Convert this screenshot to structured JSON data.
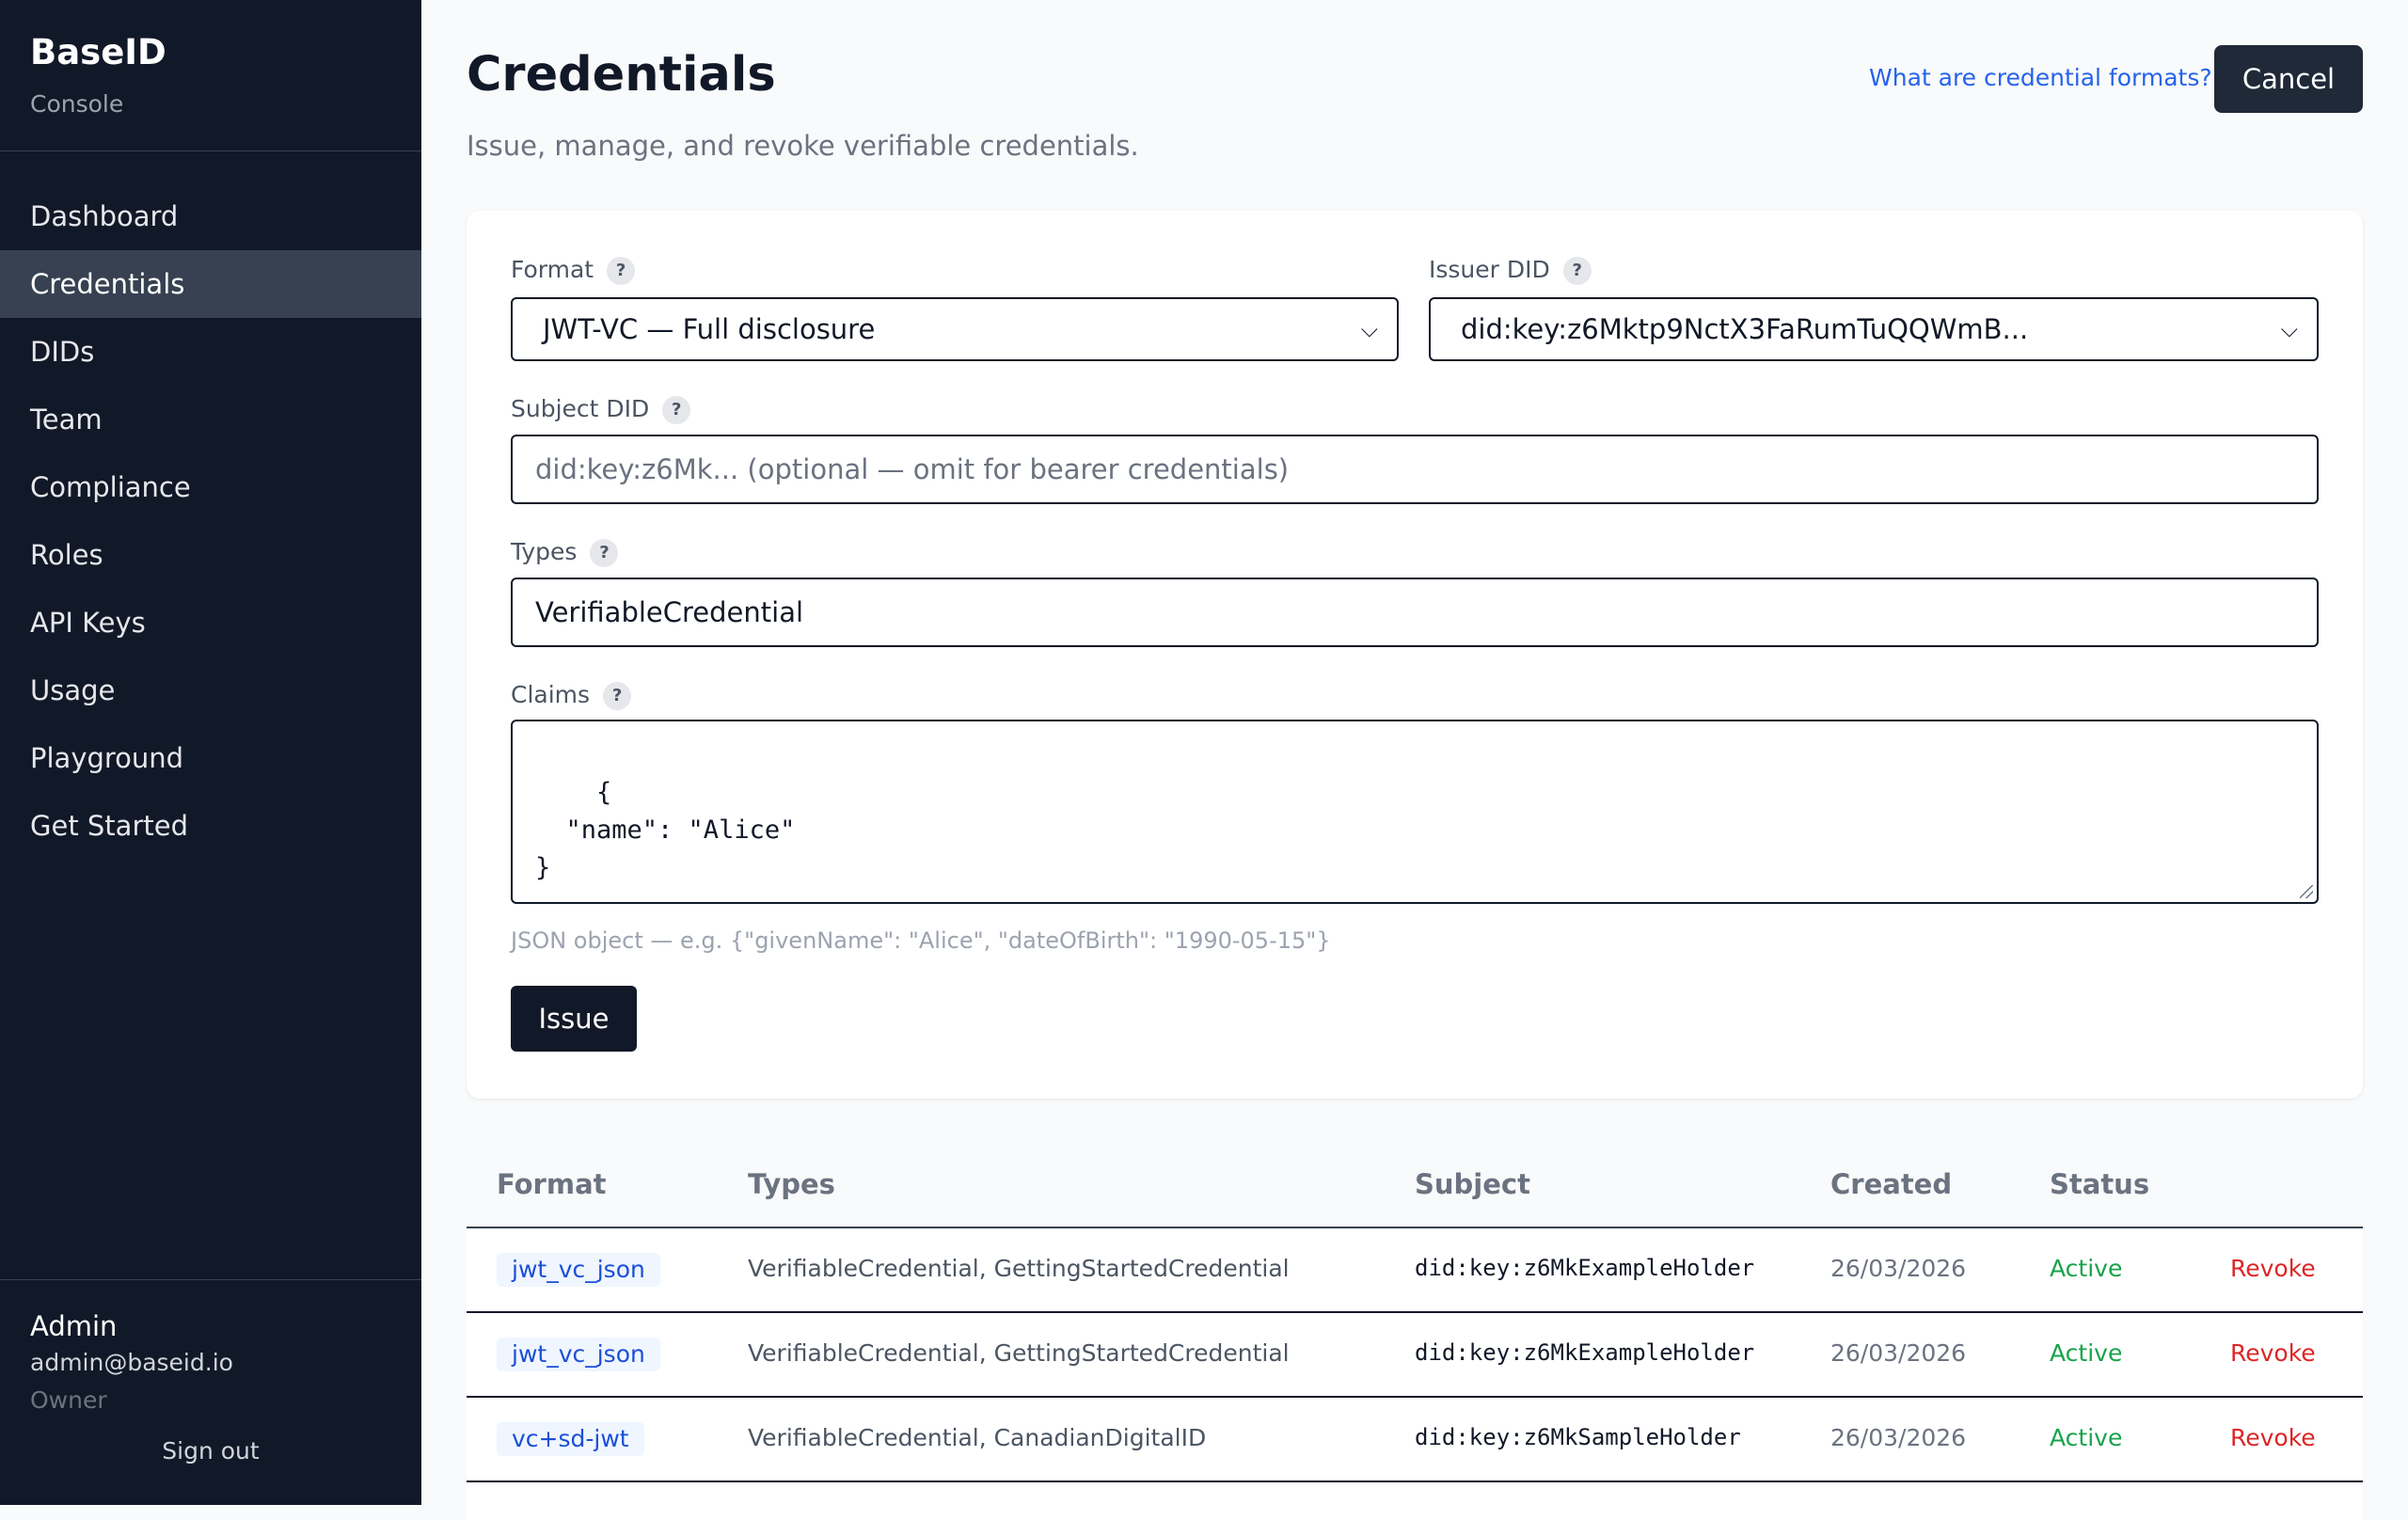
{
  "sidebar": {
    "brand": "BaseID",
    "subtitle": "Console",
    "nav": [
      {
        "label": "Dashboard"
      },
      {
        "label": "Credentials",
        "active": true
      },
      {
        "label": "DIDs"
      },
      {
        "label": "Team"
      },
      {
        "label": "Compliance"
      },
      {
        "label": "Roles"
      },
      {
        "label": "API Keys"
      },
      {
        "label": "Usage"
      },
      {
        "label": "Playground"
      },
      {
        "label": "Get Started"
      }
    ],
    "user": {
      "name": "Admin",
      "email": "admin@baseid.io",
      "role": "Owner"
    },
    "sign_out": "Sign out"
  },
  "header": {
    "title": "Credentials",
    "subtitle": "Issue, manage, and revoke verifiable credentials.",
    "help_link": "What are credential formats?",
    "cancel": "Cancel"
  },
  "form": {
    "format": {
      "label": "Format",
      "value": "JWT-VC — Full disclosure"
    },
    "issuer": {
      "label": "Issuer DID",
      "value": "did:key:z6Mktp9NctX3FaRumTuQQWmB..."
    },
    "subject": {
      "label": "Subject DID",
      "placeholder": "did:key:z6Mk... (optional — omit for bearer credentials)"
    },
    "types": {
      "label": "Types",
      "value": "VerifiableCredential"
    },
    "claims": {
      "label": "Claims",
      "value": "{\n  \"name\": \"Alice\"\n}"
    },
    "hint": "JSON object — e.g. {\"givenName\": \"Alice\", \"dateOfBirth\": \"1990-05-15\"}",
    "issue": "Issue",
    "help_glyph": "?"
  },
  "table": {
    "headers": {
      "format": "Format",
      "types": "Types",
      "subject": "Subject",
      "created": "Created",
      "status": "Status"
    },
    "rows": [
      {
        "format": "jwt_vc_json",
        "types": "VerifiableCredential, GettingStartedCredential",
        "subject": "did:key:z6MkExampleHolder",
        "created": "26/03/2026",
        "status": "Active",
        "action": "Revoke"
      },
      {
        "format": "jwt_vc_json",
        "types": "VerifiableCredential, GettingStartedCredential",
        "subject": "did:key:z6MkExampleHolder",
        "created": "26/03/2026",
        "status": "Active",
        "action": "Revoke"
      },
      {
        "format": "vc+sd-jwt",
        "types": "VerifiableCredential, CanadianDigitalID",
        "subject": "did:key:z6MkSampleHolder",
        "created": "26/03/2026",
        "status": "Active",
        "action": "Revoke"
      }
    ]
  },
  "colors": {
    "sidebar_bg": "#111827",
    "accent_link": "#2563eb",
    "status_active": "#16a34a",
    "danger": "#dc2626"
  }
}
